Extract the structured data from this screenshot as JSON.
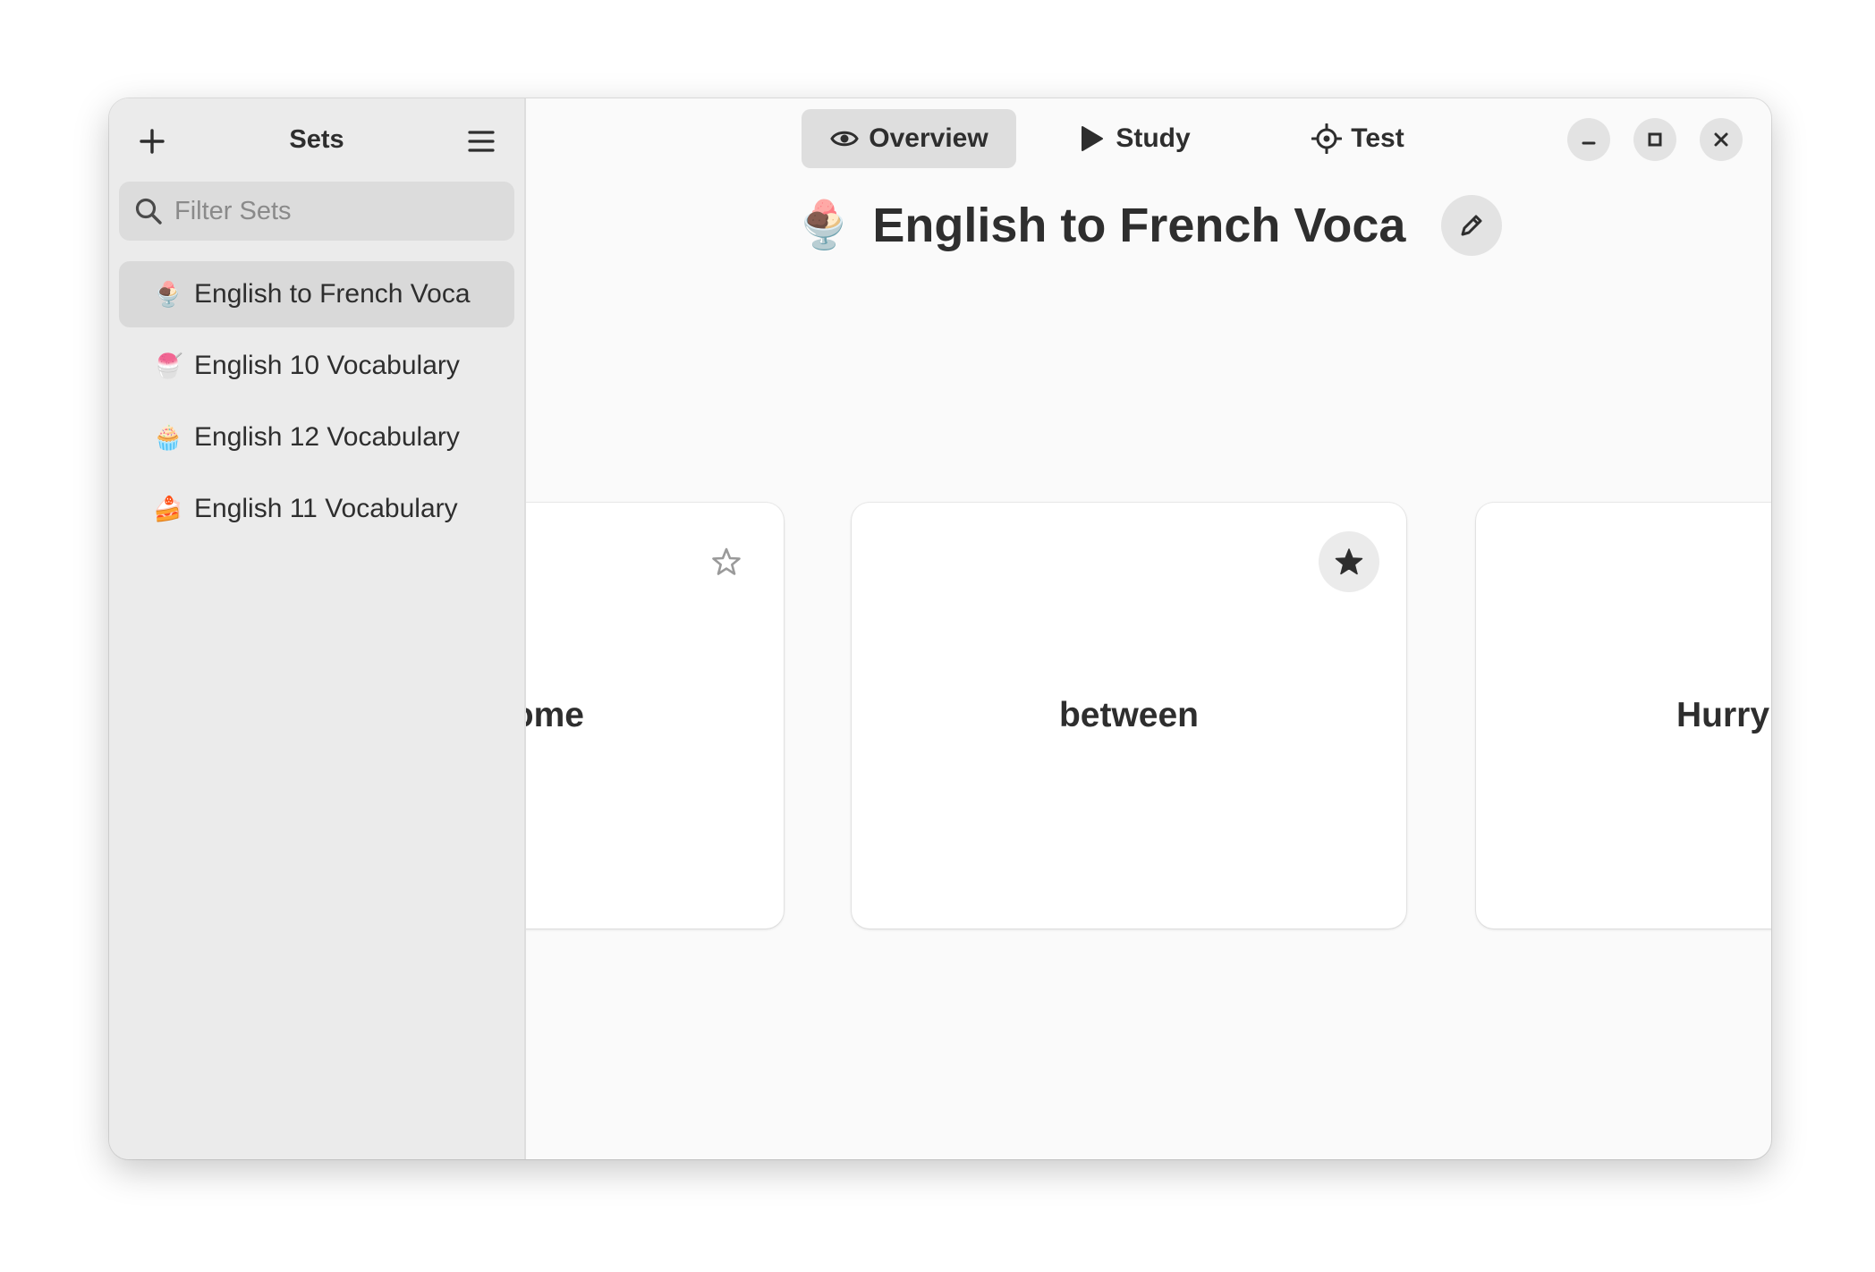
{
  "sidebar": {
    "title": "Sets",
    "search_placeholder": "Filter Sets",
    "items": [
      {
        "emoji": "🍨",
        "label": "English to French Voca",
        "selected": true
      },
      {
        "emoji": "🍧",
        "label": "English 10 Vocabulary",
        "selected": false
      },
      {
        "emoji": "🧁",
        "label": "English 12 Vocabulary",
        "selected": false
      },
      {
        "emoji": "🍰",
        "label": "English 11 Vocabulary",
        "selected": false
      }
    ]
  },
  "tabs": {
    "overview": "Overview",
    "study": "Study",
    "test": "Test",
    "active": "overview"
  },
  "header": {
    "emoji": "🍨",
    "title": "English to French Voca"
  },
  "cards": [
    {
      "term": "awesome",
      "starred": false
    },
    {
      "term": "between",
      "starred": true
    },
    {
      "term": "Hurry",
      "starred": false
    }
  ],
  "colors": {
    "sidebar_bg": "#ebebeb",
    "main_bg": "#fafafa",
    "text": "#2e2e2e",
    "selected_bg": "#d9d9d9"
  }
}
